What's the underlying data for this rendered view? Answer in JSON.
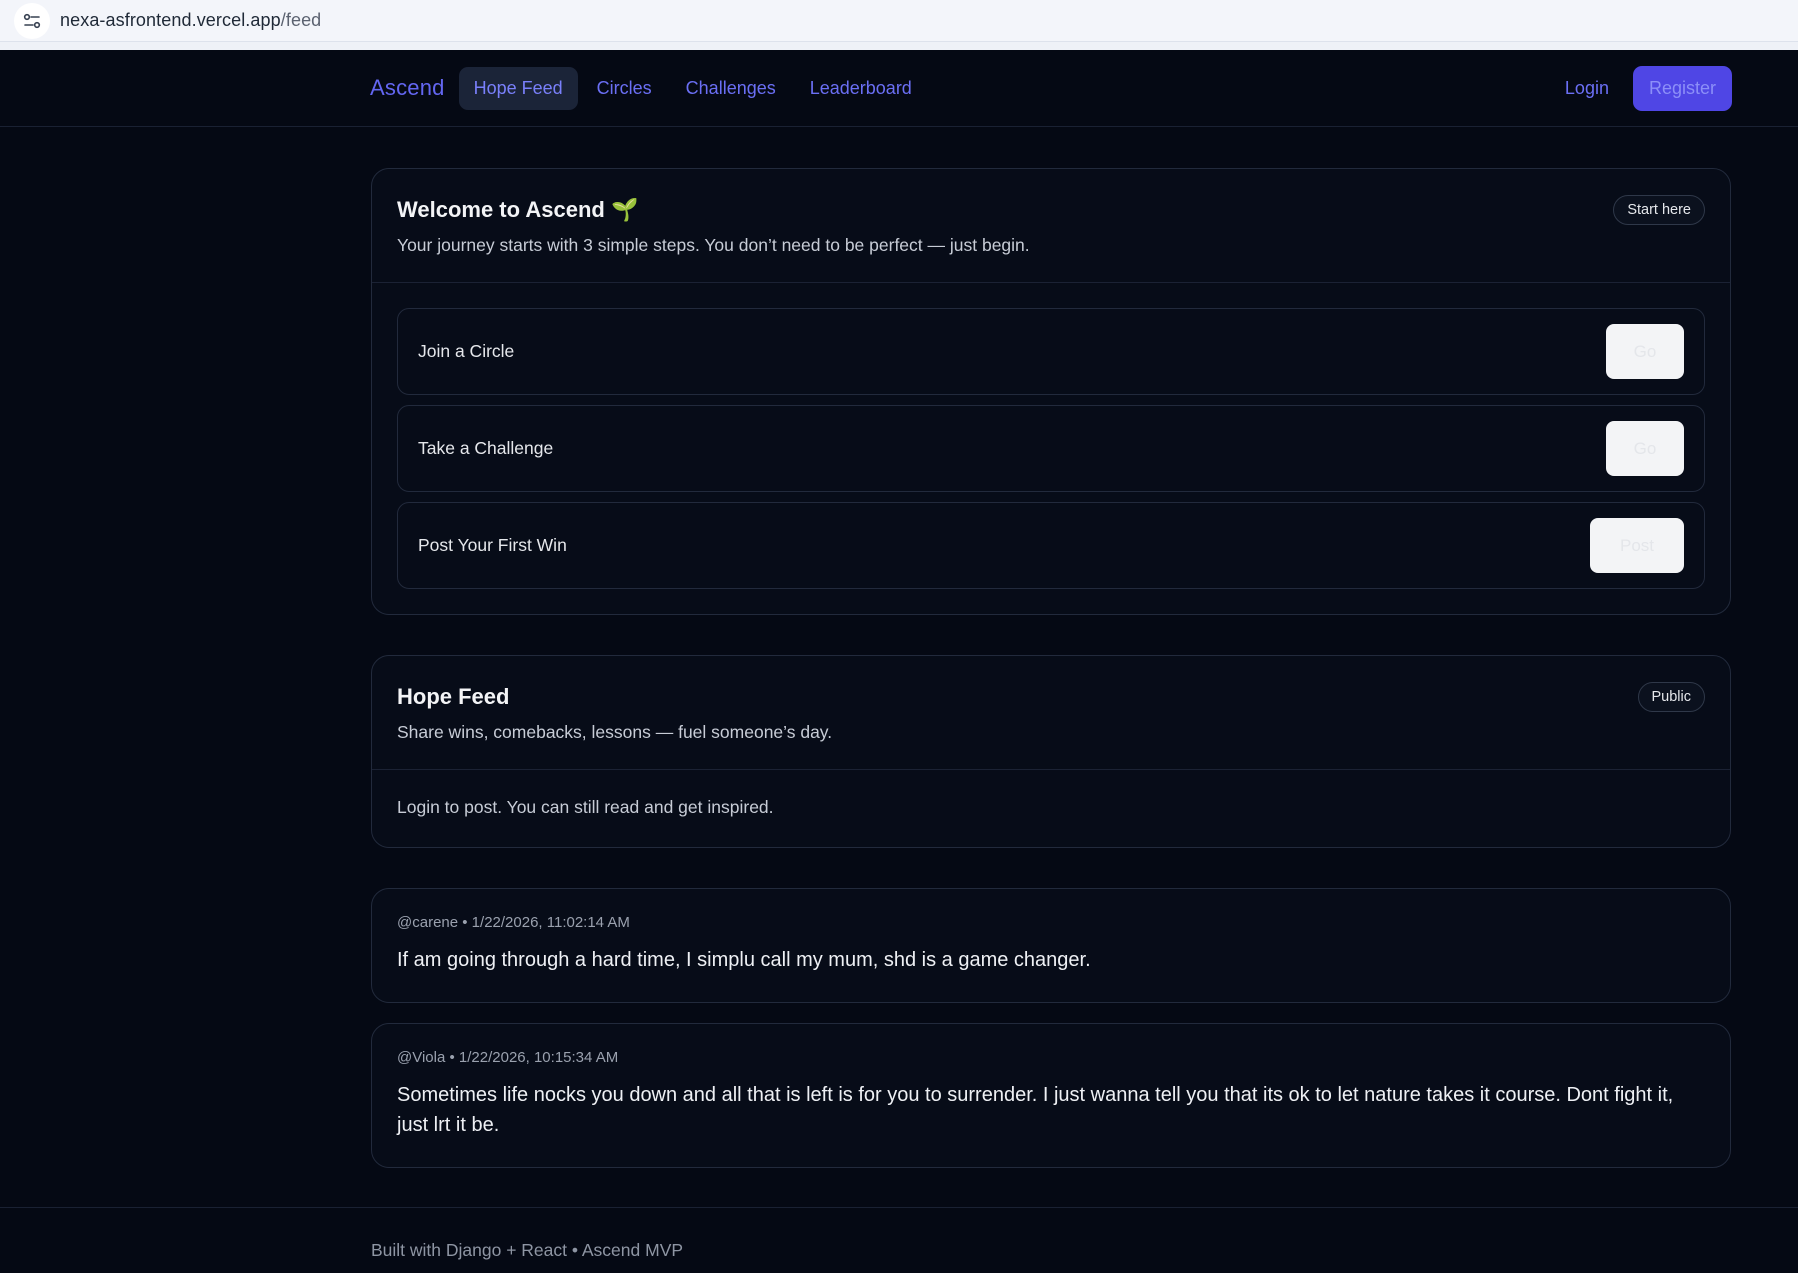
{
  "browser": {
    "url_host": "nexa-asfrontend.vercel.app",
    "url_path": "/feed",
    "site_info_icon": "tune-icon"
  },
  "nav": {
    "brand": "Ascend",
    "links": [
      {
        "label": "Hope Feed",
        "active": true
      },
      {
        "label": "Circles",
        "active": false
      },
      {
        "label": "Challenges",
        "active": false
      },
      {
        "label": "Leaderboard",
        "active": false
      }
    ],
    "login": "Login",
    "register": "Register"
  },
  "welcome": {
    "title": "Welcome to Ascend 🌱",
    "subtitle": "Your journey starts with 3 simple steps. You don’t need to be perfect — just begin.",
    "badge": "Start here",
    "steps": [
      {
        "label": "Join a Circle",
        "button": "Go"
      },
      {
        "label": "Take a Challenge",
        "button": "Go"
      },
      {
        "label": "Post Your First Win",
        "button": "Post"
      }
    ]
  },
  "feed": {
    "title": "Hope Feed",
    "subtitle": "Share wins, comebacks, lessons — fuel someone’s day.",
    "badge": "Public",
    "notice": "Login to post. You can still read and get inspired."
  },
  "posts": [
    {
      "meta": "@carene • 1/22/2026, 11:02:14 AM",
      "body": "If am going through a hard time, I simplu call my mum, shd is a game changer."
    },
    {
      "meta": "@Viola • 1/22/2026, 10:15:34 AM",
      "body": "Sometimes life nocks you down and all that is left is for you to surrender. I just wanna tell you that its ok to let nature takes it course. Dont fight it, just lrt it be."
    }
  ],
  "footer": {
    "text": "Built with Django + React • Ascend MVP"
  },
  "colors": {
    "background": "#050914",
    "accent": "#6366f1",
    "register_bg": "#4f46e5"
  }
}
